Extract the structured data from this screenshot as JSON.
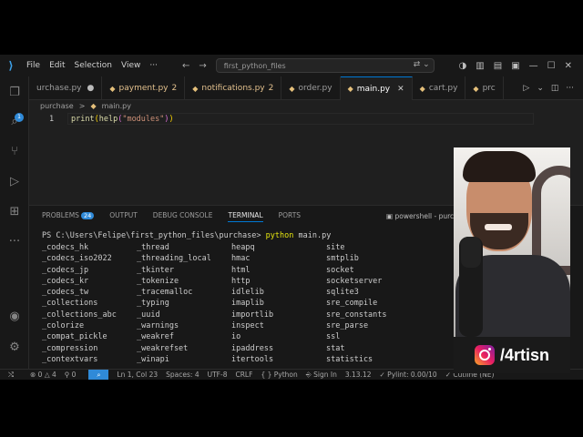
{
  "titlebar": {
    "menu": [
      "File",
      "Edit",
      "Selection",
      "View"
    ],
    "search_text": "first_python_files"
  },
  "activity": {
    "explorer_badge": "1"
  },
  "tabs": [
    {
      "label": "urchase.py",
      "dirty": true,
      "modified": false,
      "count": ""
    },
    {
      "label": "payment.py",
      "dirty": false,
      "modified": true,
      "count": "2"
    },
    {
      "label": "notifications.py",
      "dirty": false,
      "modified": true,
      "count": "2"
    },
    {
      "label": "order.py",
      "dirty": false,
      "modified": false,
      "count": ""
    },
    {
      "label": "main.py",
      "dirty": false,
      "modified": false,
      "count": "",
      "active": true
    },
    {
      "label": "cart.py",
      "dirty": false,
      "modified": false,
      "count": ""
    },
    {
      "label": "prc",
      "dirty": false,
      "modified": false,
      "count": ""
    }
  ],
  "breadcrumb": {
    "folder": "purchase",
    "separator": ">",
    "file": "main.py"
  },
  "editor": {
    "line_number": "1",
    "code": {
      "fn1": "print",
      "p1": "(",
      "fn2": "help",
      "p2": "(",
      "str": "\"modules\"",
      "p3": ")",
      "p4": ")"
    }
  },
  "panel": {
    "tabs": {
      "problems": "PROBLEMS",
      "problems_count": "24",
      "output": "OUTPUT",
      "debug": "DEBUG CONSOLE",
      "terminal": "TERMINAL",
      "ports": "PORTS"
    },
    "shell_label": "powershell - purch"
  },
  "terminal": {
    "prompt": "PS C:\\Users\\Felipe\\first_python_files\\purchase>",
    "command": "python",
    "arg": "main.py",
    "modules": [
      "_codecs_hk",
      "_thread",
      "heapq",
      "site",
      "_codecs_iso2022",
      "_threading_local",
      "hmac",
      "smtplib",
      "_codecs_jp",
      "_tkinter",
      "html",
      "socket",
      "_codecs_kr",
      "_tokenize",
      "http",
      "socketserver",
      "_codecs_tw",
      "_tracemalloc",
      "idlelib",
      "sqlite3",
      "_collections",
      "_typing",
      "imaplib",
      "sre_compile",
      "_collections_abc",
      "_uuid",
      "importlib",
      "sre_constants",
      "_colorize",
      "_warnings",
      "inspect",
      "sre_parse",
      "_compat_pickle",
      "_weakref",
      "io",
      "ssl",
      "_compression",
      "_weakrefset",
      "ipaddress",
      "stat",
      "_contextvars",
      "_winapi",
      "itertools",
      "statistics"
    ]
  },
  "statusbar": {
    "errors": "0",
    "warnings": "4",
    "ports": "0",
    "position": "Ln 1, Col 23",
    "spaces": "Spaces: 4",
    "encoding": "UTF-8",
    "eol": "CRLF",
    "language": "Python",
    "signin": "Sign In",
    "version": "3.13.12",
    "pylint": "Pylint: 0.00/10",
    "mode": "Cutline (NE)"
  },
  "webcam": {
    "handle": "/4rtisn"
  }
}
